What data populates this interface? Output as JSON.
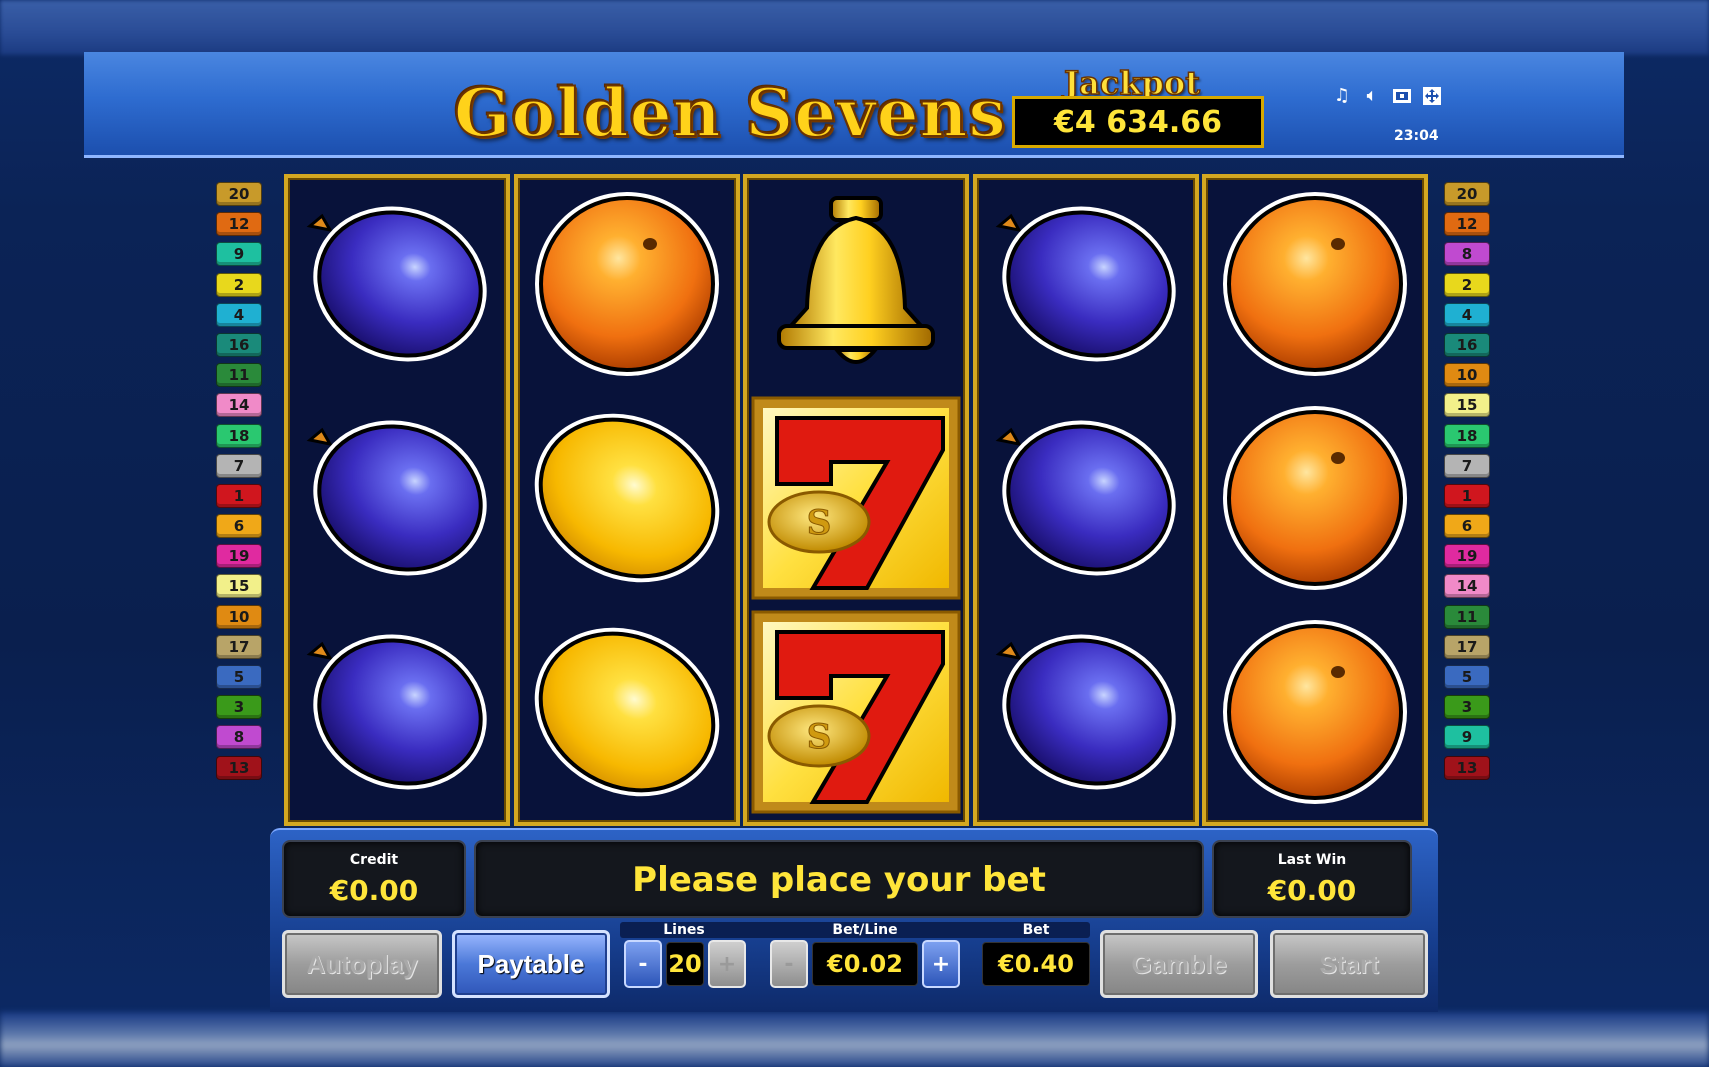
{
  "header": {
    "title": "Golden Sevens",
    "jackpot_label": "Jackpot",
    "jackpot_value": "€4 634.66",
    "clock": "23:04",
    "icons": [
      "music-icon",
      "speaker-icon",
      "info-icon",
      "fullscreen-icon"
    ]
  },
  "reels": [
    [
      "plum",
      "plum",
      "plum"
    ],
    [
      "orange",
      "lemon",
      "lemon"
    ],
    [
      "bell",
      "seven",
      "seven"
    ],
    [
      "plum",
      "plum",
      "plum"
    ],
    [
      "orange",
      "orange",
      "orange"
    ]
  ],
  "paylines_left": [
    "20",
    "12",
    "9",
    "2",
    "4",
    "16",
    "11",
    "14",
    "18",
    "7",
    "1",
    "6",
    "19",
    "15",
    "10",
    "17",
    "5",
    "3",
    "8",
    "13"
  ],
  "paylines_right": [
    "20",
    "12",
    "8",
    "2",
    "4",
    "16",
    "10",
    "15",
    "18",
    "7",
    "1",
    "6",
    "19",
    "14",
    "11",
    "17",
    "5",
    "3",
    "9",
    "13"
  ],
  "panel": {
    "credit_label": "Credit",
    "credit_value": "€0.00",
    "message": "Please place your bet",
    "lastwin_label": "Last Win",
    "lastwin_value": "€0.00",
    "autoplay_label": "Autoplay",
    "paytable_label": "Paytable",
    "lines_label": "Lines",
    "lines_value": "20",
    "betline_label": "Bet/Line",
    "betline_value": "€0.02",
    "bet_label": "Bet",
    "bet_value": "€0.40",
    "gamble_label": "Gamble",
    "start_label": "Start",
    "minus": "-",
    "plus": "+"
  },
  "colors": {
    "accent_yellow": "#ffe53a",
    "reel_bg": "#08123a",
    "reel_border": "#d4a821"
  }
}
